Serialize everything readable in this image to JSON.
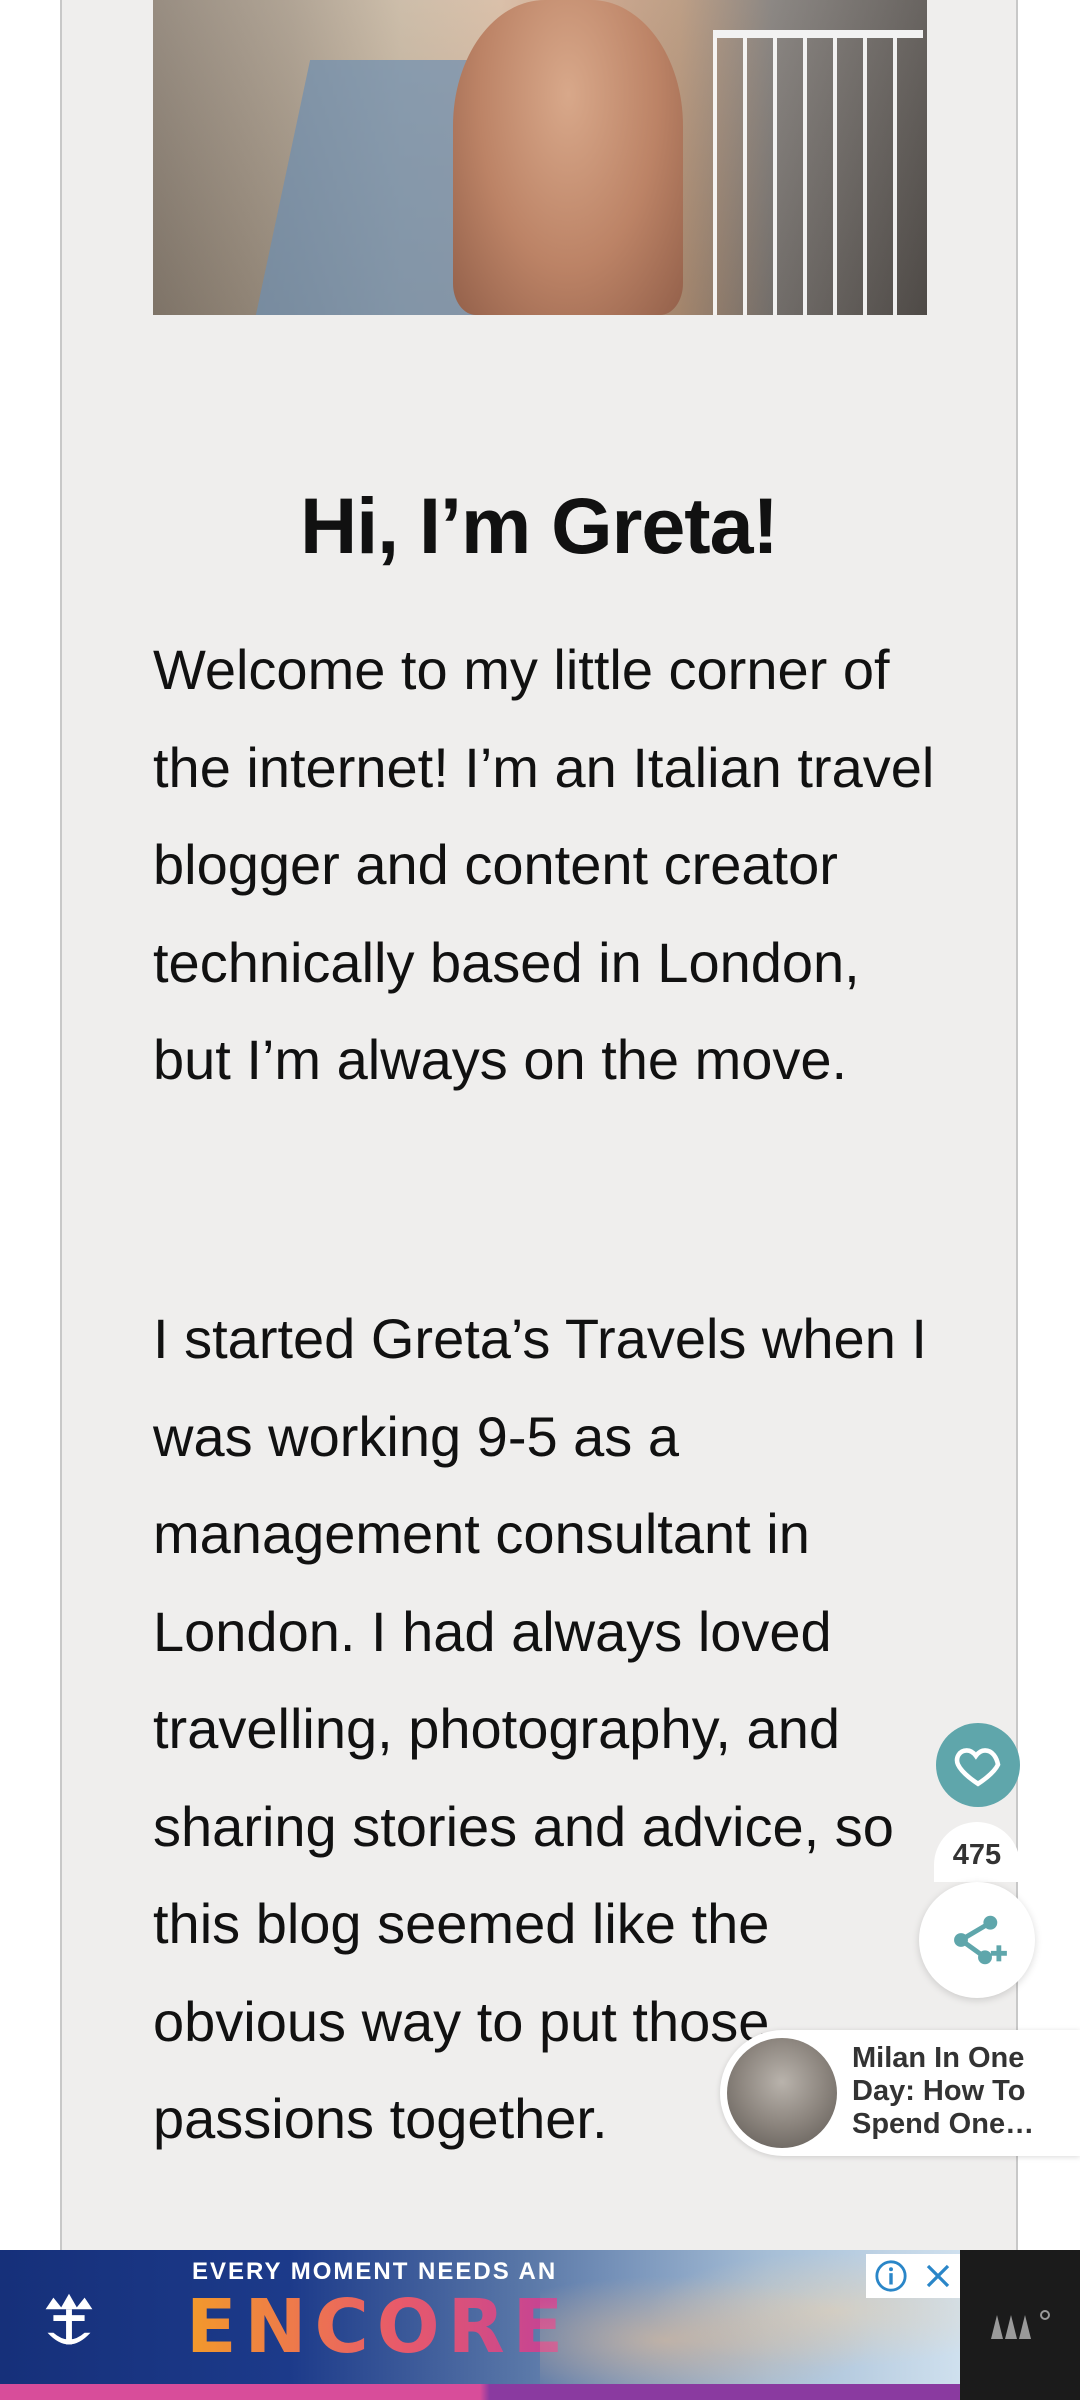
{
  "about": {
    "heading": "Hi, I’m Greta!",
    "paragraph_1": "Welcome to my little corner of the internet! I’m an Italian travel blogger and content creator technically based in London, but I’m always on the move.",
    "paragraph_2": "I started Greta’s Travels when I was working 9-5 as a management consultant in London. I had always loved travelling, photography, and sharing stories and advice, so this blog seemed like the obvious way to put those passions together."
  },
  "floating_actions": {
    "share_count": "475",
    "like_icon": "heart-icon",
    "share_icon": "share-icon",
    "accent_color": "#5fa6ab"
  },
  "related_post": {
    "title": "Milan In One Day: How To Spend One…"
  },
  "ad": {
    "tagline": "EVERY MOMENT NEEDS AN",
    "brand_word": "ENCORE",
    "info_icon": "info-icon",
    "close_icon": "close-icon"
  }
}
